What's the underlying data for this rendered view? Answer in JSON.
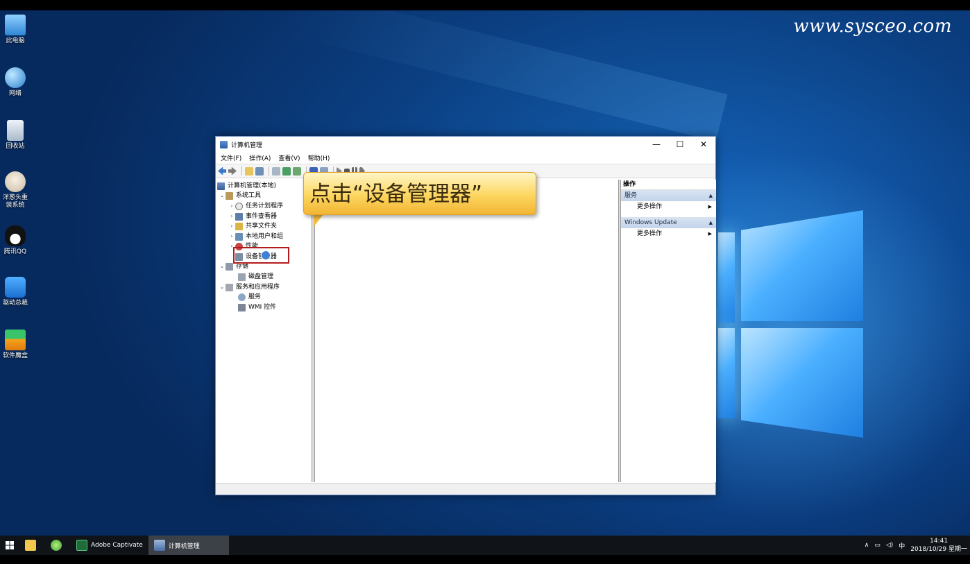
{
  "watermark": "www.sysceo.com",
  "desktop_icons": [
    {
      "label": "此电脑",
      "color": "#4aa3e8"
    },
    {
      "label": "网络",
      "color": "#3b8fd8"
    },
    {
      "label": "回收站",
      "color": "#c8d6e6"
    },
    {
      "label": "洋葱头重装系统",
      "color": "#e8e2d6"
    },
    {
      "label": "腾讯QQ",
      "color": "#1a1a1a"
    },
    {
      "label": "驱动总裁",
      "color": "#2f8de4"
    },
    {
      "label": "软件魔盒",
      "color": "#f2a01c"
    }
  ],
  "window": {
    "title": "计算机管理",
    "controls": {
      "minimize": "—",
      "maximize": "☐",
      "close": "✕"
    },
    "menu": [
      "文件(F)",
      "操作(A)",
      "查看(V)",
      "帮助(H)"
    ]
  },
  "tree": {
    "root": "计算机管理(本地)",
    "system_tools": "系统工具",
    "task_scheduler": "任务计划程序",
    "event_viewer": "事件查看器",
    "shared_folders": "共享文件夹",
    "local_users": "本地用户和组",
    "performance": "性能",
    "device_manager": "设备管理器",
    "storage": "存储",
    "disk_management": "磁盘管理",
    "services_apps": "服务和应用程序",
    "services": "服务",
    "wmi": "WMI 控件"
  },
  "actions": {
    "header": "操作",
    "section1": "服务",
    "section1_item": "更多操作",
    "section2": "Windows Update",
    "section2_item": "更多操作"
  },
  "callout": "点击“设备管理器”",
  "taskbar": {
    "captivate": "Adobe Captivate",
    "active_window": "计算机管理",
    "ime": "中",
    "time": "14:41",
    "date": "2018/10/29 星期一"
  }
}
